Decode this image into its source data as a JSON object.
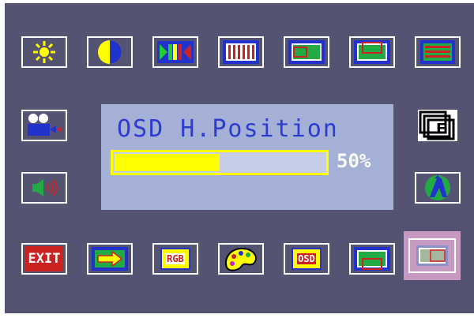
{
  "osd": {
    "title": "OSD H.Position",
    "value_text": "50%",
    "value_fraction": 0.5
  },
  "icons": {
    "row_top": [
      "brightness-icon",
      "contrast-icon",
      "color-bars-icon",
      "stripes-icon",
      "h-position-icon",
      "v-position-icon",
      "h-size-icon"
    ],
    "left": [
      "video-source-icon",
      "volume-icon"
    ],
    "right": [
      "recall-f-icon",
      "auto-adjust-icon"
    ],
    "row_bottom": [
      "exit-icon",
      "input-arrow-icon",
      "rgb-icon",
      "palette-icon",
      "osd-icon",
      "osd-v-position-icon",
      "osd-h-position-icon"
    ]
  },
  "labels": {
    "exit": "EXIT",
    "rgb": "RGB",
    "osd": "OSD",
    "recall": "F"
  },
  "colors": {
    "background": "#545472",
    "panel": "#a4b0d6",
    "accent": "#ffff00",
    "title_text": "#2d3bd0",
    "selected": "#c79ac2"
  }
}
